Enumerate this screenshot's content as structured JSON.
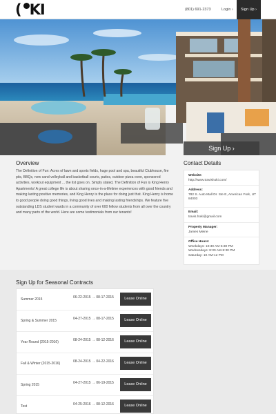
{
  "header": {
    "logo_text": "KI",
    "phone": "(801) 691-2373",
    "login": "Login ›",
    "signup": "Sign Up ›"
  },
  "hero": {
    "signup": "Sign Up ›"
  },
  "overview": {
    "title": "Overview",
    "text": "The Definition of Fun: Acres of lawn and sports fields, huge pool and spa, beautiful Clubhouse, fire pits, BBQs, new sand volleyball and basketball courts, patios, outdoor pizza oven, sponsored activities, workout equipment ... the list goes on. Simply stated, The Definition of Fun is King Henry Apartments! A great college life is about sharing once-in-a-lifetime experiences with good friends and making lasting positive memories, and King Henry is the place for doing just that. King Henry is home to good people doing good things, living good lives and making lasting friendships. We feature five outstanding LDS student wards in a community of over 600 fellow students from all over the country and many parts of the world. Here are some testimonials from our tenants!"
  },
  "contact": {
    "title": "Contact Details",
    "website_label": "Website:",
    "website": "http://www.travishoki.com/",
    "address_label": "Address:",
    "address": "782 S. Auto Mall Dr. Ste E, American Fork, UT 84003",
    "email_label": "Email:",
    "email": "travis.hoki@gmail.com",
    "manager_label": "Property Manager:",
    "manager": "James Meine",
    "hours_label": "Office Hours:",
    "hours": [
      "Weekdays: 10:30 AM-5:30 PM",
      "Wednesdays: 8:30 AM-5:30 PM",
      "Saturday: 10 AM-12 PM"
    ]
  },
  "contracts": {
    "title": "Sign Up for Seasonal Contracts",
    "lease_label": "Lease Online",
    "rows": [
      {
        "term": "Summer 2015",
        "start": "06-22-2015",
        "end": "08-17-2015"
      },
      {
        "term": "Spring & Summer 2015",
        "start": "04-27-2015",
        "end": "08-17-2015"
      },
      {
        "term": "Year Round (2015-2016)",
        "start": "08-24-2015",
        "end": "08-12-2016"
      },
      {
        "term": "Fall & Winter (2015-2016)",
        "start": "08-24-2015",
        "end": "04-22-2016"
      },
      {
        "term": "Spring 2015",
        "start": "04-27-2015",
        "end": "06-19-2015"
      },
      {
        "term": "Test",
        "start": "04-25-2016",
        "end": "08-12-2016"
      }
    ]
  },
  "colors": {
    "dark_button": "#3a3a3a",
    "header_signup_bg": "#2b2b2b",
    "sky": "#5d9ed8",
    "ocean": "#1d6fb0"
  }
}
